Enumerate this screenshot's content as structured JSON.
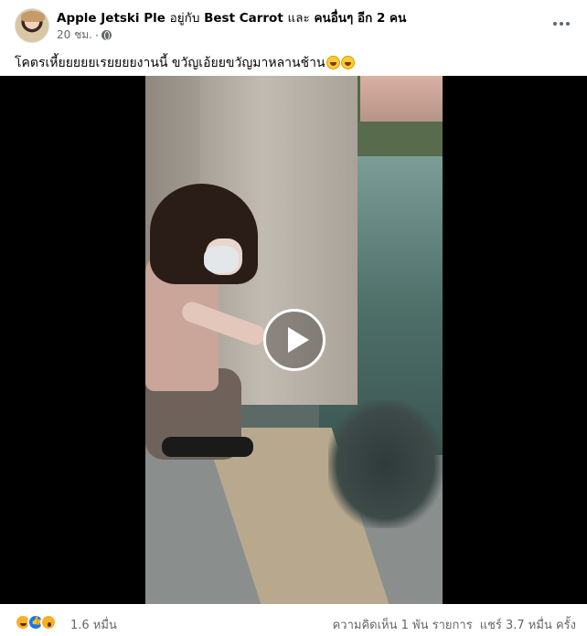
{
  "header": {
    "author": "Apple Jetski Ple",
    "with_text": "อยู่กับ",
    "tagged": "Best Carrot",
    "and_text": "และ",
    "others": "คนอื่นๆ อีก 2 คน",
    "time": "20 ชม.",
    "separator": "·",
    "privacy_icon": "globe-icon",
    "more_icon": "more-options-icon"
  },
  "caption": {
    "text": "โคตรเหี้ยยยยยเรยยยยงานนี้ ขวัญเอ้ยยขวัญมาหลานช้าน",
    "emojis": [
      "rofl-emoji",
      "rofl-emoji"
    ]
  },
  "video": {
    "play_icon": "play-icon"
  },
  "footer": {
    "reaction_icons": [
      "haha-reaction-icon",
      "like-reaction-icon",
      "wow-reaction-icon"
    ],
    "reaction_count": "1.6 หมื่น",
    "comments": "ความคิดเห็น 1 พัน รายการ",
    "shares": "แชร์ 3.7 หมื่น ครั้ง"
  },
  "colors": {
    "secondary_text": "#65676b",
    "reaction_like": "#1877f2",
    "reaction_haha": "#f7b125"
  }
}
